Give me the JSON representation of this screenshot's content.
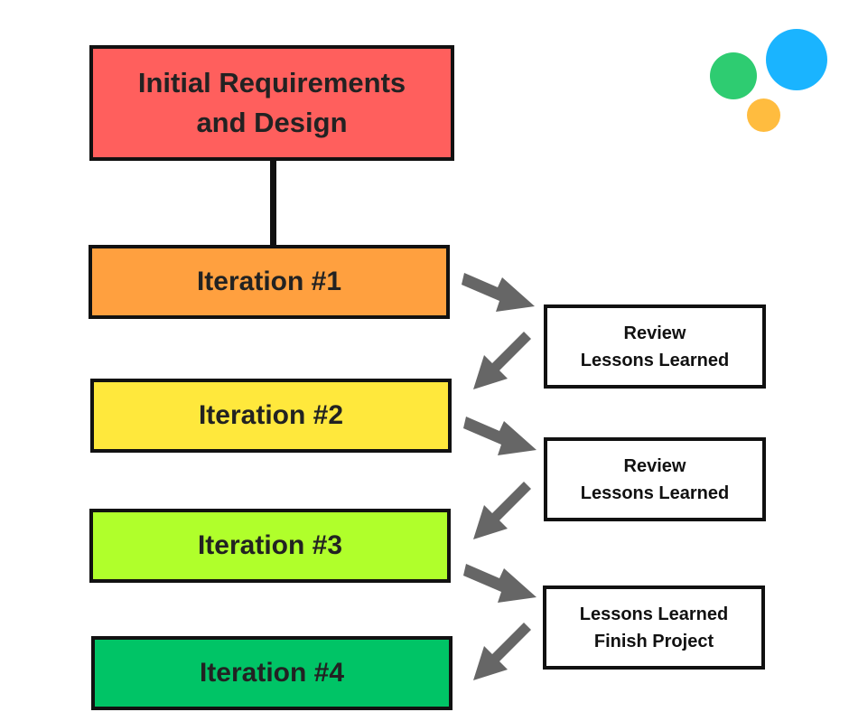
{
  "diagram": {
    "start": {
      "line1": "Initial Requirements",
      "line2": "and Design",
      "color": "#FF5F5D"
    },
    "iterations": [
      {
        "label": "Iteration #1",
        "color": "#FFA03F"
      },
      {
        "label": "Iteration #2",
        "color": "#FFE83C"
      },
      {
        "label": "Iteration #3",
        "color": "#B0FF2B"
      },
      {
        "label": "Iteration #4",
        "color": "#00C466"
      }
    ],
    "reviews": [
      {
        "line1": "Review",
        "line2": "Lessons Learned"
      },
      {
        "line1": "Review",
        "line2": "Lessons Learned"
      },
      {
        "line1": "Lessons Learned",
        "line2": "Finish Project"
      }
    ],
    "arrow_color": "#666666",
    "logo": {
      "colors": [
        "#2ECC71",
        "#1AB4FF",
        "#FFBC3F"
      ]
    }
  }
}
